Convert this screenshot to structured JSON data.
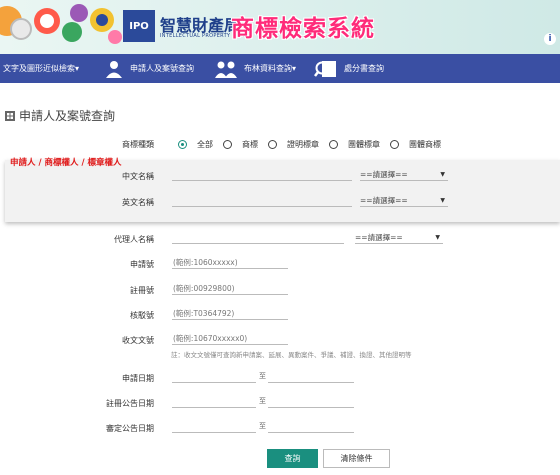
{
  "header": {
    "agency_zh": "智慧財產局",
    "agency_en": "INTELLECTUAL PROPERTY OFFICE",
    "system_title": "商標檢索系統",
    "logo_text": "IPO",
    "info_icon": "info-icon"
  },
  "nav": {
    "items": [
      {
        "label": "文字及圖形近似檢索▾",
        "icon": ""
      },
      {
        "label": "申請人及案號查詢",
        "icon": "person-icon"
      },
      {
        "label": "布林資料查詢▾",
        "icon": "people-icon"
      },
      {
        "label": "處分書查詢",
        "icon": "magnifier-doc-icon"
      }
    ]
  },
  "page": {
    "title": "申請人及案號查詢"
  },
  "form": {
    "type_label": "商標種類",
    "type_options": [
      "全部",
      "商標",
      "證明標章",
      "團體標章",
      "團體商標"
    ],
    "type_selected": "全部",
    "applicant_note": "申請人 / 商標權人 / 標章權人",
    "chinese_name_label": "中文名稱",
    "chinese_name_value": "",
    "chinese_select": "==請選擇==",
    "english_name_label": "英文名稱",
    "english_name_value": "",
    "english_select": "==請選擇==",
    "agent_label": "代理人名稱",
    "agent_value": "",
    "agent_select": "==請選擇==",
    "app_no_label": "申請號",
    "app_no_placeholder": "(範例:1060xxxxx)",
    "reg_no_label": "註冊號",
    "reg_no_placeholder": "(範例:00929800)",
    "approval_no_label": "核駁號",
    "approval_no_placeholder": "(範例:T0364792)",
    "doc_no_label": "收文文號",
    "doc_no_placeholder": "(範例:10670xxxxx0)",
    "doc_no_note": "註：收文文號僅可查詢新申請案、延展、異動案件、爭議、補證、換證、其他證明等",
    "app_date_label": "申請日期",
    "reg_pub_date_label": "註冊公告日期",
    "review_pub_date_label": "審定公告日期",
    "to_label": "至",
    "search_button": "查詢",
    "clear_button": "清除條件"
  },
  "colors": {
    "nav_bg": "#3a4fa3",
    "accent": "#1a8f7f",
    "title_pink": "#ff2b7a",
    "note_red": "#e01b1b"
  }
}
